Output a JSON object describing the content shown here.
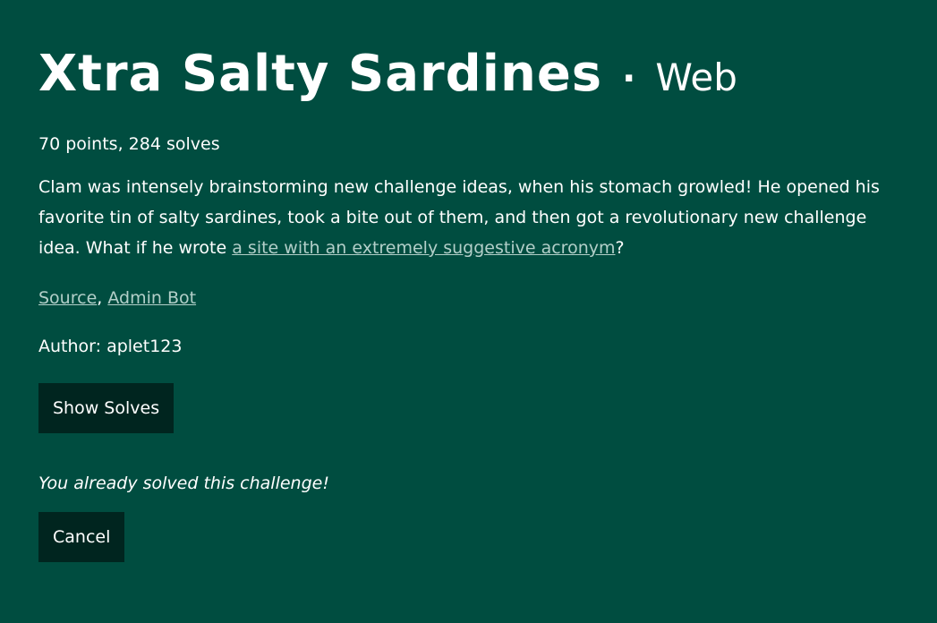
{
  "challenge": {
    "title": "Xtra Salty Sardines",
    "separator": "·",
    "category": "Web",
    "meta": "70 points, 284 solves",
    "description_before": "Clam was intensely brainstorming new challenge ideas, when his stomach growled! He opened his favorite tin of salty sardines, took a bite out of them, and then got a revolutionary new challenge idea. What if he wrote ",
    "description_link": "a site with an extremely suggestive acronym",
    "description_after": "?",
    "files": [
      {
        "label": "Source"
      },
      {
        "label": "Admin Bot"
      }
    ],
    "file_separator": ",",
    "author": "Author: aplet123",
    "show_solves_label": "Show Solves",
    "solved_message": "You already solved this challenge!",
    "cancel_label": "Cancel"
  },
  "colors": {
    "background": "#004d40",
    "button": "#00251f",
    "link": "#b3cfc9",
    "text": "#ffffff"
  }
}
